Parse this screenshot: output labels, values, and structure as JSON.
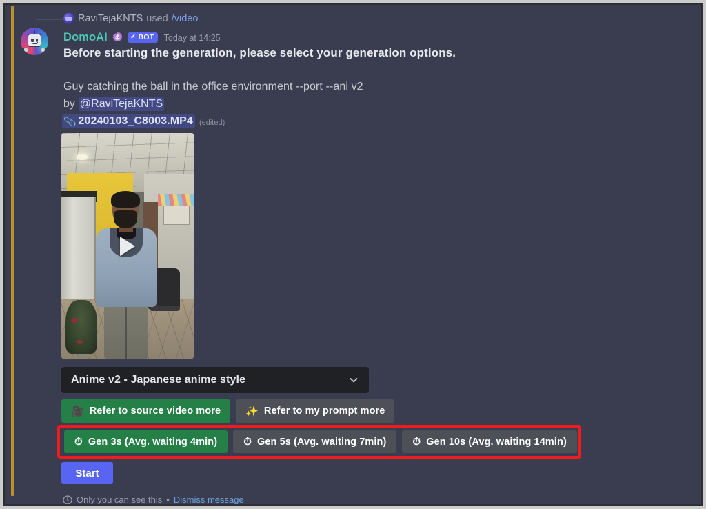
{
  "colors": {
    "chat_bg": "#393d4f",
    "accent_blurple": "#5865f2",
    "green_button": "#248046",
    "grey_button": "#4e5058",
    "highlight_red": "#ee1c1c",
    "bot_name_teal": "#4dc7b8",
    "link_blue": "#6ca2e0",
    "spine_yellow": "#b99326"
  },
  "interaction": {
    "avatar_icon": "user-avatar-icon",
    "username": "RaviTejaKNTS",
    "used_label": "used",
    "command": "/video"
  },
  "message": {
    "avatar_icon": "domoai-bot-avatar",
    "bot_name": "DomoAI",
    "verified_icon": "verified-app-gear-icon",
    "bot_tag": "BOT",
    "bot_tag_check": "✓",
    "timestamp": "Today at 14:25",
    "intro": "Before starting the generation, please select your generation options.",
    "prompt": "Guy catching the ball in the office environment --port --ani v2",
    "by_label": "by",
    "mention": "@RaviTejaKNTS",
    "attachment_icon": "paperclip-icon",
    "attachment_name": "20240103_C8003.MP4",
    "edited_tag": "(edited)"
  },
  "video": {
    "play_icon": "play-triangle-icon",
    "alt": "office-video-thumbnail"
  },
  "style_select": {
    "value": "Anime v2 - Japanese anime style",
    "chevron_icon": "chevron-down-icon"
  },
  "refer_buttons": [
    {
      "label": "Refer to source video more",
      "icon": "🎥",
      "icon_name": "movie-camera-icon",
      "style": "green"
    },
    {
      "label": "Refer to my prompt more",
      "icon": "✨",
      "icon_name": "sparkles-icon",
      "style": "grey"
    }
  ],
  "gen_buttons": [
    {
      "label": "Gen 3s (Avg. waiting 4min)",
      "icon": "⏱",
      "icon_name": "stopwatch-icon",
      "style": "green"
    },
    {
      "label": "Gen 5s (Avg. waiting 7min)",
      "icon": "⏱",
      "icon_name": "stopwatch-icon",
      "style": "grey"
    },
    {
      "label": "Gen 10s (Avg. waiting 14min)",
      "icon": "⏱",
      "icon_name": "stopwatch-icon",
      "style": "grey"
    }
  ],
  "start_button": {
    "label": "Start"
  },
  "ephemeral": {
    "eye_icon": "eye-icon",
    "text": "Only you can see this",
    "separator": "•",
    "dismiss": "Dismiss message"
  }
}
